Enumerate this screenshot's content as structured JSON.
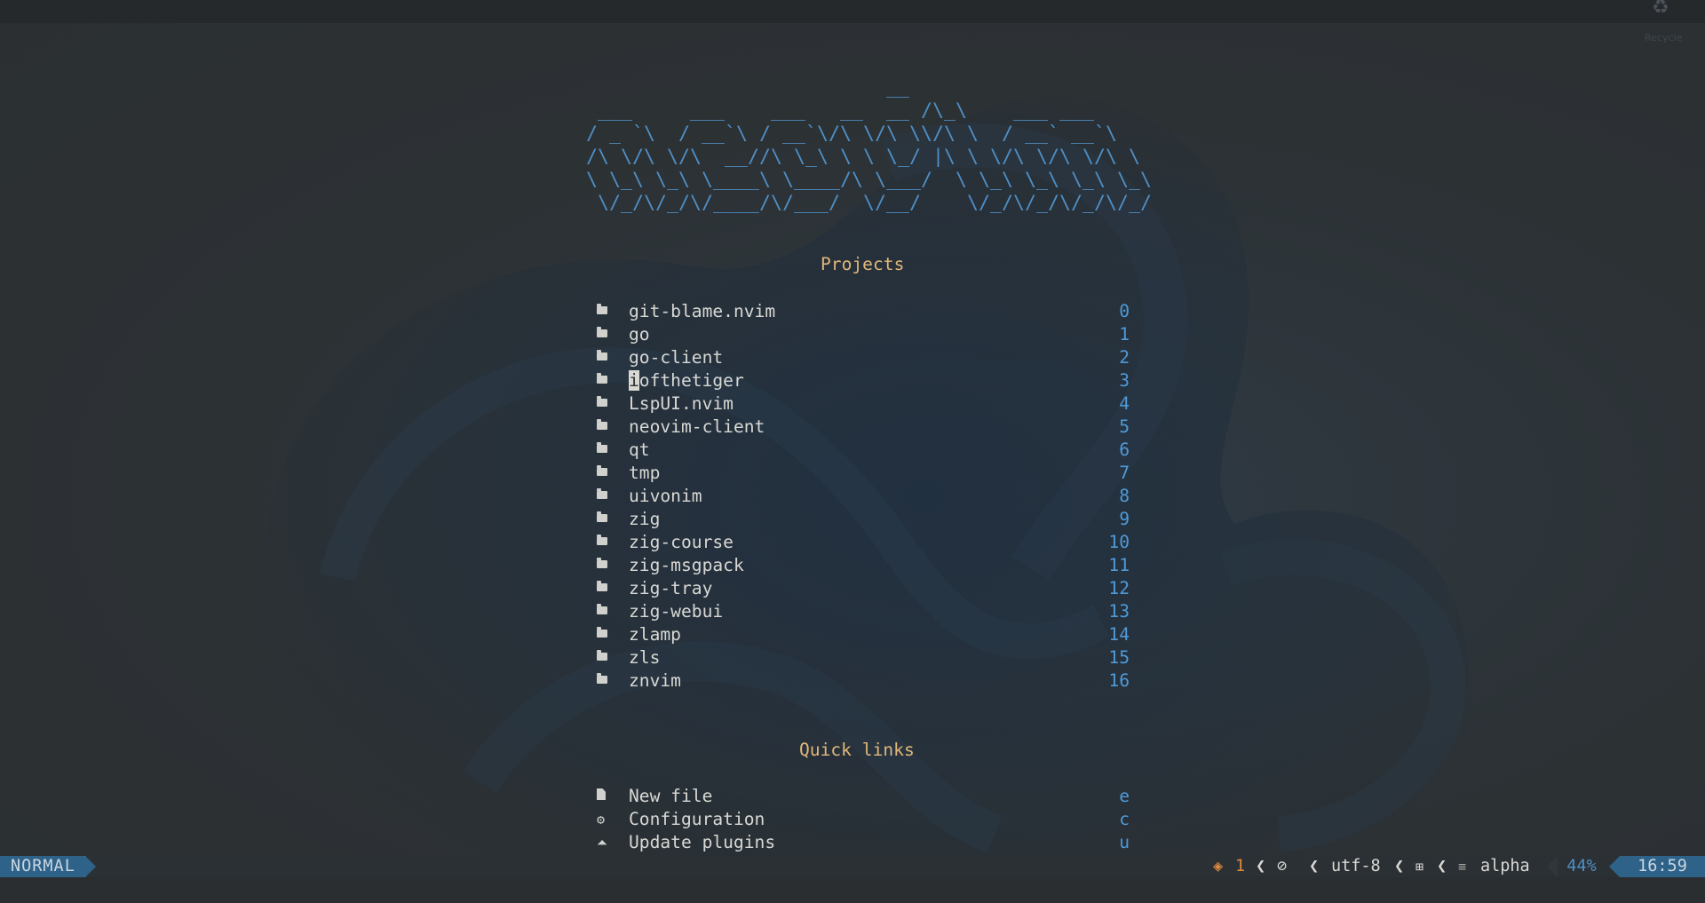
{
  "desktop": {
    "recycle_label": "Recycle"
  },
  "banner": {
    "lines": [
      "                          __",
      " ___     ___    ___   __  __ /\\_\\    ___ ___",
      "/ _ `\\  / __`\\ / __`\\/\\ \\/\\ \\\\/\\ \\  / __` __`\\",
      "/\\ \\/\\ \\/\\  __//\\ \\_\\ \\ \\ \\_/ |\\ \\ \\/\\ \\/\\ \\/\\ \\",
      "\\ \\_\\ \\_\\ \\____\\ \\____/\\ \\___/  \\ \\_\\ \\_\\ \\_\\ \\_\\",
      " \\/_/\\/_/\\/____/\\/___/  \\/__/    \\/_/\\/_/\\/_/\\/_/"
    ]
  },
  "projects": {
    "title": "Projects",
    "items": [
      {
        "name": "git-blame.nvim",
        "key": "0"
      },
      {
        "name": "go",
        "key": "1"
      },
      {
        "name": "go-client",
        "key": "2"
      },
      {
        "name": "iofthetiger",
        "key": "3"
      },
      {
        "name": "LspUI.nvim",
        "key": "4"
      },
      {
        "name": "neovim-client",
        "key": "5"
      },
      {
        "name": "qt",
        "key": "6"
      },
      {
        "name": "tmp",
        "key": "7"
      },
      {
        "name": "uivonim",
        "key": "8"
      },
      {
        "name": "zig",
        "key": "9"
      },
      {
        "name": "zig-course",
        "key": "10"
      },
      {
        "name": "zig-msgpack",
        "key": "11"
      },
      {
        "name": "zig-tray",
        "key": "12"
      },
      {
        "name": "zig-webui",
        "key": "13"
      },
      {
        "name": "zlamp",
        "key": "14"
      },
      {
        "name": "zls",
        "key": "15"
      },
      {
        "name": "znvim",
        "key": "16"
      }
    ]
  },
  "quick_links": {
    "title": "Quick links",
    "items": [
      {
        "name": "New file",
        "key": "e",
        "icon": "file-icon"
      },
      {
        "name": "Configuration",
        "key": "c",
        "icon": "gear-icon"
      },
      {
        "name": "Update plugins",
        "key": "u",
        "icon": "update-icon"
      }
    ]
  },
  "statusline": {
    "mode": "NORMAL",
    "diagnostics_count": "1",
    "no_lsp_symbol": "⊘",
    "encoding": "utf-8",
    "filetype": "alpha",
    "percent": "44%",
    "time": "16:59"
  },
  "colors": {
    "accent": "#4f8fc5",
    "title": "#e0b77a",
    "mode_bg": "#2f6289",
    "warning": "#e08a3c"
  }
}
